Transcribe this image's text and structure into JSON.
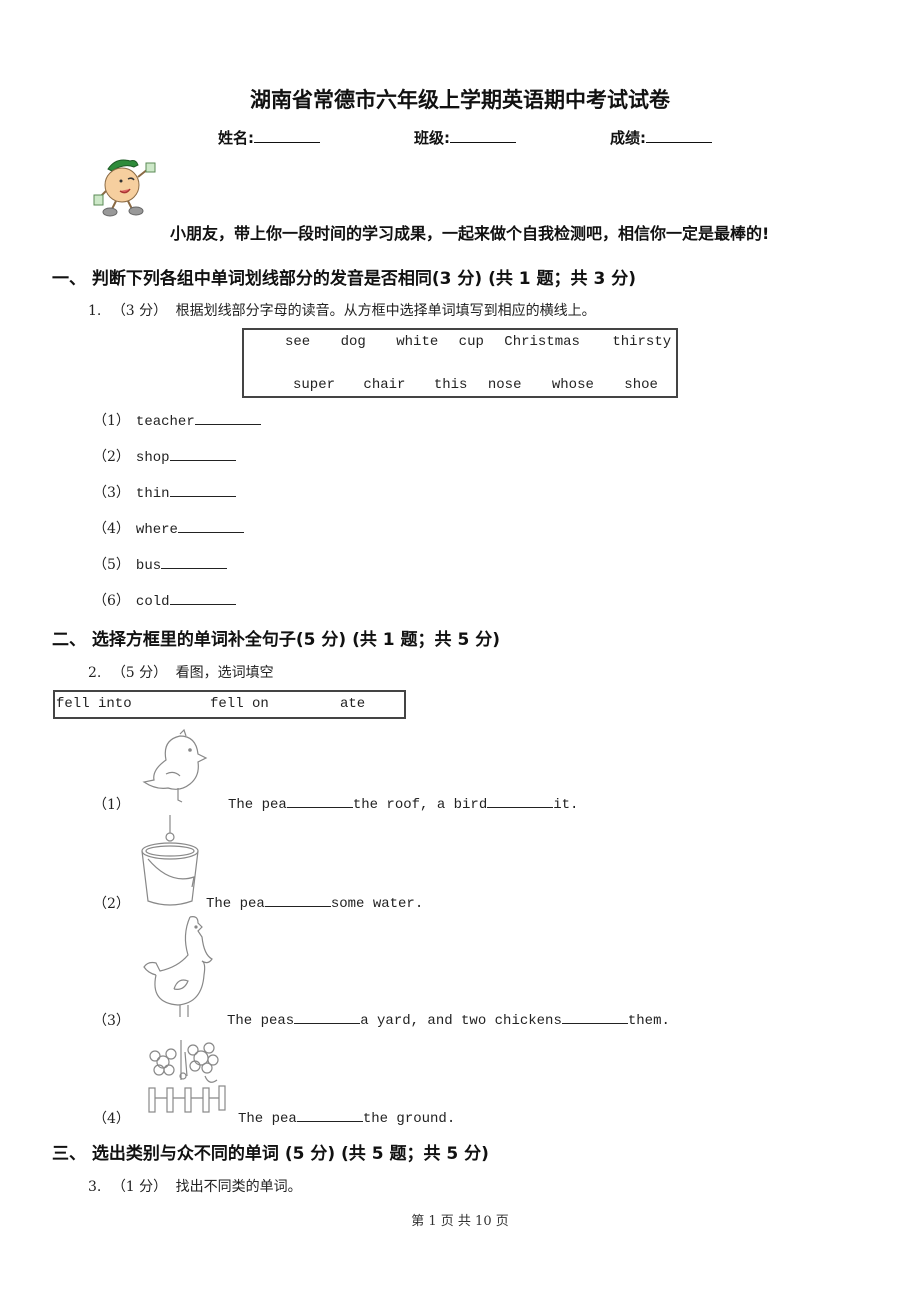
{
  "header": {
    "title": "湖南省常德市六年级上学期英语期中考试试卷",
    "fields": [
      {
        "label": "姓名:"
      },
      {
        "label": "班级:"
      },
      {
        "label": "成绩:"
      }
    ]
  },
  "intro": {
    "mascot": "mascot-boy-icon",
    "slogan": "小朋友，带上你一段时间的学习成果，一起来做个自我检测吧，相信你一定是最棒的!"
  },
  "sections": [
    {
      "heading": "一、  判断下列各组中单词划线部分的发音是否相同(3 分) (共 1 题；共 3 分)",
      "question": {
        "number": "1.",
        "points": "（3 分）",
        "instruction": "根据划线部分字母的读音。从方框中选择单词填写到相应的横线上。",
        "word_box": {
          "row1": [
            "see",
            "dog",
            "white",
            "cup",
            "Christmas",
            "thirsty"
          ],
          "row2": [
            "super",
            "chair",
            "this",
            "nose",
            "whose",
            "shoe"
          ]
        },
        "items": [
          {
            "num": "（1）",
            "word": "teacher"
          },
          {
            "num": "（2）",
            "word": "shop"
          },
          {
            "num": "（3）",
            "word": "thin"
          },
          {
            "num": "（4）",
            "word": "where"
          },
          {
            "num": "（5）",
            "word": "bus"
          },
          {
            "num": "（6）",
            "word": "cold"
          }
        ]
      }
    },
    {
      "heading": "二、  选择方框里的单词补全句子(5 分) (共 1 题；共 5 分)",
      "question": {
        "number": "2.",
        "points": "（5 分）",
        "instruction": "看图，选词填空",
        "word_box": [
          "fell into",
          "fell on",
          "ate"
        ],
        "items": [
          {
            "num": "（1）",
            "image": "bird-icon",
            "parts": [
              "The pea",
              "the roof, a bird",
              "it."
            ]
          },
          {
            "num": "（2）",
            "image": "bucket-icon",
            "parts": [
              "The pea",
              "some water."
            ]
          },
          {
            "num": "（3）",
            "image": "chicken-icon",
            "parts": [
              "The peas",
              "a yard, and two chickens",
              "them."
            ]
          },
          {
            "num": "（4）",
            "image": "flowers-fence-icon",
            "parts": [
              "The pea",
              "the ground."
            ]
          }
        ]
      }
    },
    {
      "heading": "三、  选出类别与众不同的单词 (5 分) (共 5 题；共 5 分)",
      "question": {
        "number": "3.",
        "points": "（1 分）",
        "instruction": "找出不同类的单词。"
      }
    }
  ],
  "footer": {
    "page_text": "第 1 页 共 10 页"
  }
}
